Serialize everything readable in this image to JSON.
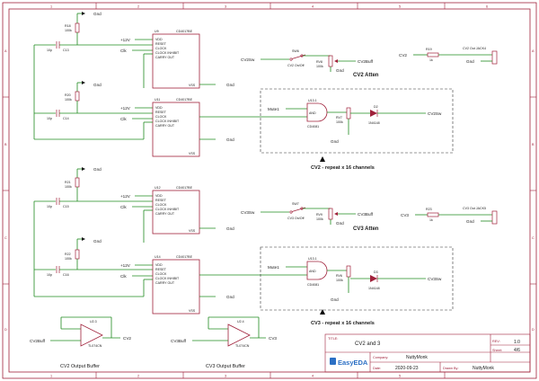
{
  "frame": {
    "cols": [
      "1",
      "2",
      "3",
      "4",
      "5",
      "6"
    ],
    "rows": [
      "A",
      "B",
      "C",
      "D"
    ]
  },
  "title_block": {
    "title_label": "TITLE:",
    "title": "CV2 and 3",
    "rev_label": "REV:",
    "rev": "1.0",
    "company_label": "Company:",
    "company": "NuttyMonk",
    "sheet_label": "Sheet:",
    "sheet": "4/6",
    "date_label": "Date:",
    "date": "2020-09-23",
    "drawn_label": "Drawn By:",
    "drawn_by": "NuttyMonk",
    "logo": "EasyEDA"
  },
  "ics": {
    "u9": {
      "ref": "U9",
      "part": "CD4017BE"
    },
    "u11": {
      "ref": "U11",
      "part": "CD4017BE"
    },
    "u12": {
      "ref": "U12",
      "part": "CD4017BE"
    },
    "u14": {
      "ref": "U14",
      "part": "CD4017BE"
    },
    "pins": [
      "VDD",
      "RESET",
      "CLOCK",
      "CLOCK INHIBIT",
      "CARRY OUT"
    ],
    "vss": "VSS"
  },
  "resistors": {
    "r18": {
      "ref": "R18",
      "val": "100k"
    },
    "r20": {
      "ref": "R20",
      "val": "100k"
    },
    "r21": {
      "ref": "R21",
      "val": "100k"
    },
    "r22": {
      "ref": "R22",
      "val": "100k"
    },
    "r19": {
      "ref": "R19",
      "val": "1k"
    },
    "r23": {
      "ref": "R23",
      "val": "1k"
    }
  },
  "caps": {
    "c13": {
      "ref": "C13",
      "val": "10p"
    },
    "c14": {
      "ref": "C14",
      "val": "10p"
    },
    "c15": {
      "ref": "C15",
      "val": "10p"
    },
    "c16": {
      "ref": "C16",
      "val": "10p"
    }
  },
  "pots": {
    "rv8": {
      "ref": "RV8",
      "val": "100k"
    },
    "rv9": {
      "ref": "RV9",
      "val": "100k"
    },
    "rv7": {
      "ref": "RV7",
      "val": "100k"
    },
    "rv6": {
      "ref": "RV6",
      "val": "100k"
    }
  },
  "switches": {
    "sw6": {
      "ref": "SW6",
      "name": "CV2 On/Off"
    },
    "sw7": {
      "ref": "SW7",
      "name": "CV3 On/Off"
    }
  },
  "gates": {
    "u13_1": {
      "ref": "U13.1",
      "type": "AND",
      "part": "CD4081"
    },
    "u13_2": {
      "ref": "U13.1",
      "type": "AND",
      "part": "CD4081"
    }
  },
  "diodes": {
    "d2": {
      "ref": "D2",
      "part": "1N4148"
    },
    "d3": {
      "ref": "D3",
      "part": "1N4148"
    }
  },
  "opamps": {
    "u23": {
      "ref": "U2.3",
      "part": "TL074CN",
      "in": "CV2Buff",
      "out": "CV2",
      "title": "CV2 Output Buffer"
    },
    "u24": {
      "ref": "U2.4",
      "part": "TL074CN",
      "in": "CV3Buff",
      "out": "CV3",
      "title": "CV3 Output Buffer"
    }
  },
  "nets": {
    "gnd": "Gnd",
    "v12": "+12V",
    "clk": "Clk",
    "cv2sw": "CV2Sw",
    "cv3sw": "CV3Sw",
    "cv2buff": "CV2Buff",
    "cv3buff": "CV3Buff",
    "cv2": "CV2",
    "cv3": "CV3",
    "mute1": "Mute1"
  },
  "jacks": {
    "j4": "CV2 Out JACK4",
    "j5": "CV3 Out JACK5"
  },
  "section_labels": {
    "cv2_atten": "CV2 Atten",
    "cv3_atten": "CV3 Atten",
    "cv2_repeat": "CV2 - repeat x 16 channels",
    "cv3_repeat": "CV3 - repeat x 16 channels"
  }
}
